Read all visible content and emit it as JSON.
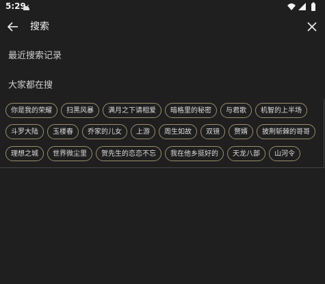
{
  "status_bar": {
    "time": "5:29",
    "icons": [
      "android-icon",
      "wifi-icon",
      "signal-icon",
      "battery-icon"
    ]
  },
  "header": {
    "back_icon": "arrow-left-icon",
    "title": "搜索",
    "close_icon": "close-icon"
  },
  "recent": {
    "title": "最近搜索记录"
  },
  "popular": {
    "title": "大家都在搜",
    "rows": [
      [
        "你是我的荣耀",
        "扫黑风暴",
        "满月之下请相爱",
        "暗格里的秘密",
        "与君歌",
        "机智的上半场"
      ],
      [
        "斗罗大陆",
        "玉楼春",
        "乔家的儿女",
        "上游",
        "周生如故",
        "双镜",
        "赘婿",
        "披荆斩棘的哥哥"
      ],
      [
        "理想之城",
        "世界微尘里",
        "贺先生的恋恋不忘",
        "我在他乡挺好的",
        "天龙八部",
        "山河令"
      ]
    ]
  },
  "colors": {
    "background": "#1f1f1f",
    "tag_border": "#9a8e6e",
    "text": "#e8e8e8"
  }
}
